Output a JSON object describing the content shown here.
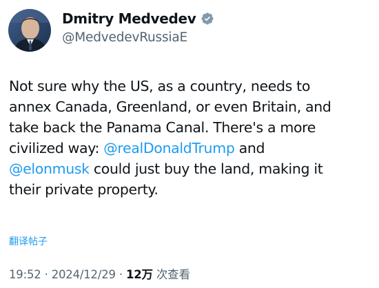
{
  "author": {
    "display_name": "Dmitry Medvedev",
    "handle": "@MedvedevRussiaE",
    "verified": true,
    "avatar_icon": "profile-photo",
    "verified_icon": "verified-badge-icon",
    "verified_color": "#829aab"
  },
  "tweet": {
    "lines": [
      [
        {
          "text": "Not sure why the US, as a country, needs to"
        }
      ],
      [
        {
          "text": "annex Canada, Greenland, or even Britain, and"
        }
      ],
      [
        {
          "text": "take back the Panama Canal. There's a more"
        }
      ],
      [
        {
          "text": "civilized way: "
        },
        {
          "text": "@realDonaldTrump",
          "mention": true
        },
        {
          "text": " and"
        }
      ],
      [
        {
          "text": "@elonmusk",
          "mention": true
        },
        {
          "text": " could just buy the land, making it"
        }
      ],
      [
        {
          "text": "their private property."
        }
      ]
    ],
    "translate_label": "翻译帖子"
  },
  "meta": {
    "time": "19:52",
    "separator": "·",
    "date": "2024/12/29",
    "views_count": "12万",
    "views_label": "次查看"
  },
  "colors": {
    "text": "#0f1419",
    "secondary": "#536471",
    "link": "#1d9bf0"
  }
}
